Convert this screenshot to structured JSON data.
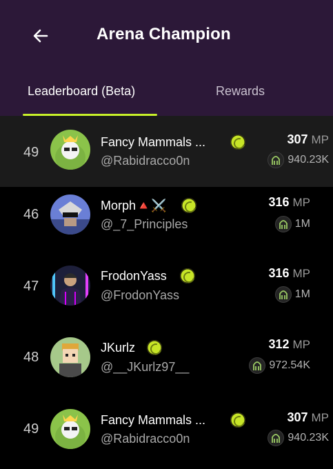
{
  "header": {
    "title": "Arena Champion",
    "back_icon": "arrow-left-icon",
    "background": "#2c1838"
  },
  "tabs": [
    {
      "label": "Leaderboard (Beta)",
      "active": true
    },
    {
      "label": "Rewards",
      "active": false
    }
  ],
  "accent_color": "#c8f02a",
  "badge_icon": "verified-badge-icon",
  "token_icon": "token-coin-icon",
  "leaderboard": [
    {
      "rank": "49",
      "name": "Fancy Mammals ...",
      "handle": "@Rabidracco0n",
      "mp": "307",
      "mp_unit": "MP",
      "tokens": "940.23K",
      "highlight": true
    },
    {
      "rank": "46",
      "name": "Morph🔺⚔️",
      "handle": "@_7_Principles",
      "mp": "316",
      "mp_unit": "MP",
      "tokens": "1M"
    },
    {
      "rank": "47",
      "name": "FrodonYass",
      "handle": "@FrodonYass",
      "mp": "316",
      "mp_unit": "MP",
      "tokens": "1M"
    },
    {
      "rank": "48",
      "name": "JKurlz",
      "handle": "@__JKurlz97__",
      "mp": "312",
      "mp_unit": "MP",
      "tokens": "972.54K"
    },
    {
      "rank": "49",
      "name": "Fancy Mammals ...",
      "handle": "@Rabidracco0n",
      "mp": "307",
      "mp_unit": "MP",
      "tokens": "940.23K"
    }
  ]
}
